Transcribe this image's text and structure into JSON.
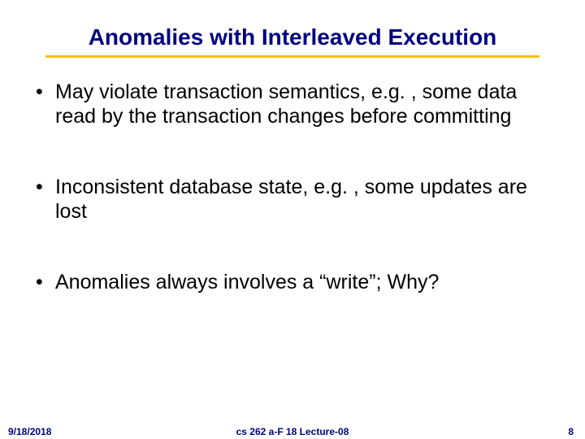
{
  "slide": {
    "title": "Anomalies with Interleaved Execution",
    "bullets": [
      "May violate transaction semantics, e.g. , some data read by the transaction changes before committing",
      "Inconsistent database state, e.g. , some updates are lost",
      "Anomalies always involves a “write”; Why?"
    ]
  },
  "footer": {
    "date": "9/18/2018",
    "course": "cs 262 a-F 18 Lecture-08",
    "page": "8"
  }
}
